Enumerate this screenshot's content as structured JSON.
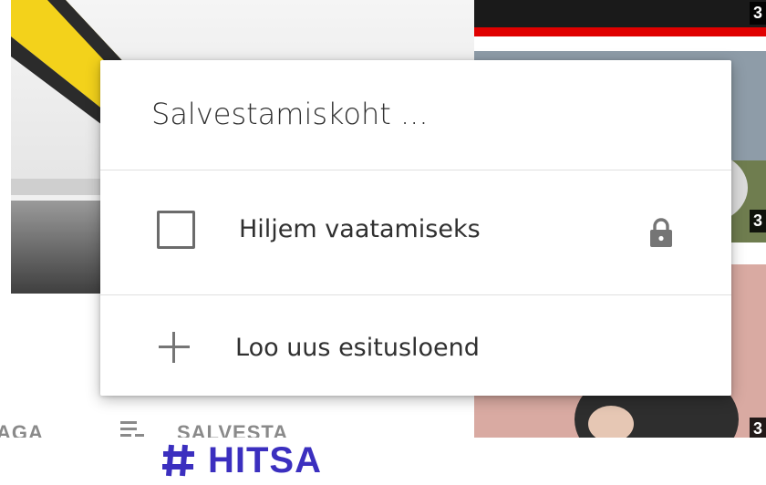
{
  "menu": {
    "title": "Salvestamiskoht ...",
    "options": [
      {
        "label": "Hiljem vaatamiseks",
        "checked": false,
        "icon": "lock-icon"
      }
    ],
    "create": {
      "label": "Loo uus esitusloend",
      "icon": "plus-icon"
    }
  },
  "background": {
    "actions": {
      "left_partial": "AGA",
      "save_label": "SALVESTA"
    },
    "duration_badges": [
      "3",
      "3",
      "3"
    ]
  },
  "footer": {
    "logo_text": "HITSA",
    "icon": "hash-icon",
    "brand_color": "#3b2fbf"
  },
  "colors": {
    "accent_red": "#e00000",
    "menu_text": "#303030",
    "icon_gray": "#757575"
  }
}
